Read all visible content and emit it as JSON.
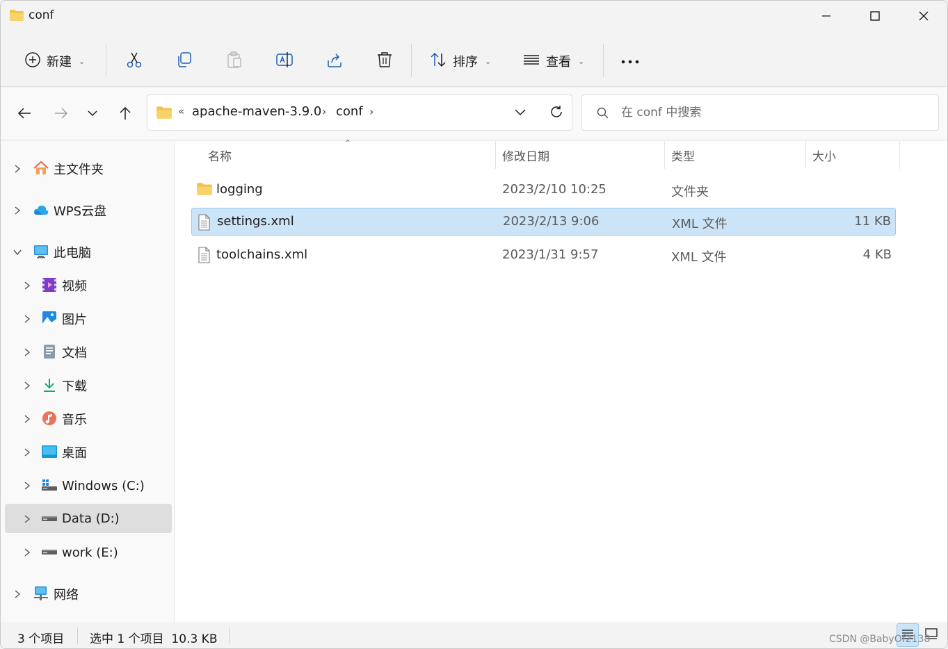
{
  "window": {
    "title": "conf"
  },
  "toolbar": {
    "new_label": "新建",
    "sort_label": "排序",
    "view_label": "查看"
  },
  "address": {
    "overflow": "«",
    "crumbs": [
      "apache-maven-3.9.0",
      "conf"
    ]
  },
  "search": {
    "placeholder": "在 conf 中搜索"
  },
  "sidebar": {
    "items": [
      {
        "label": "主文件夹",
        "icon": "home-icon"
      },
      {
        "label": "WPS云盘",
        "icon": "cloud-icon"
      },
      {
        "label": "此电脑",
        "icon": "computer-icon"
      },
      {
        "label": "视频",
        "icon": "video-icon"
      },
      {
        "label": "图片",
        "icon": "picture-icon"
      },
      {
        "label": "文档",
        "icon": "document-icon"
      },
      {
        "label": "下载",
        "icon": "download-icon"
      },
      {
        "label": "音乐",
        "icon": "music-icon"
      },
      {
        "label": "桌面",
        "icon": "desktop-icon"
      },
      {
        "label": "Windows (C:)",
        "icon": "windows-drive-icon"
      },
      {
        "label": "Data (D:)",
        "icon": "drive-icon"
      },
      {
        "label": "work (E:)",
        "icon": "drive-icon"
      },
      {
        "label": "网络",
        "icon": "network-icon"
      }
    ],
    "selected": "Data (D:)"
  },
  "columns": {
    "name": "名称",
    "date": "修改日期",
    "type": "类型",
    "size": "大小"
  },
  "files": [
    {
      "name": "logging",
      "date": "2023/2/10 10:25",
      "type": "文件夹",
      "size": "",
      "icon": "folder-icon"
    },
    {
      "name": "settings.xml",
      "date": "2023/2/13 9:06",
      "type": "XML 文件",
      "size": "11 KB",
      "icon": "file-icon"
    },
    {
      "name": "toolchains.xml",
      "date": "2023/1/31 9:57",
      "type": "XML 文件",
      "size": "4 KB",
      "icon": "file-icon"
    }
  ],
  "status": {
    "count": "3 个项目",
    "selection": "选中 1 个项目  10.3 KB"
  },
  "watermark": "CSDN @BabyOf2138",
  "colors": {
    "selection": "#cce4f7",
    "selection_border": "#99c9ef",
    "folder": "#f2c14e",
    "accent": "#0067c0"
  }
}
